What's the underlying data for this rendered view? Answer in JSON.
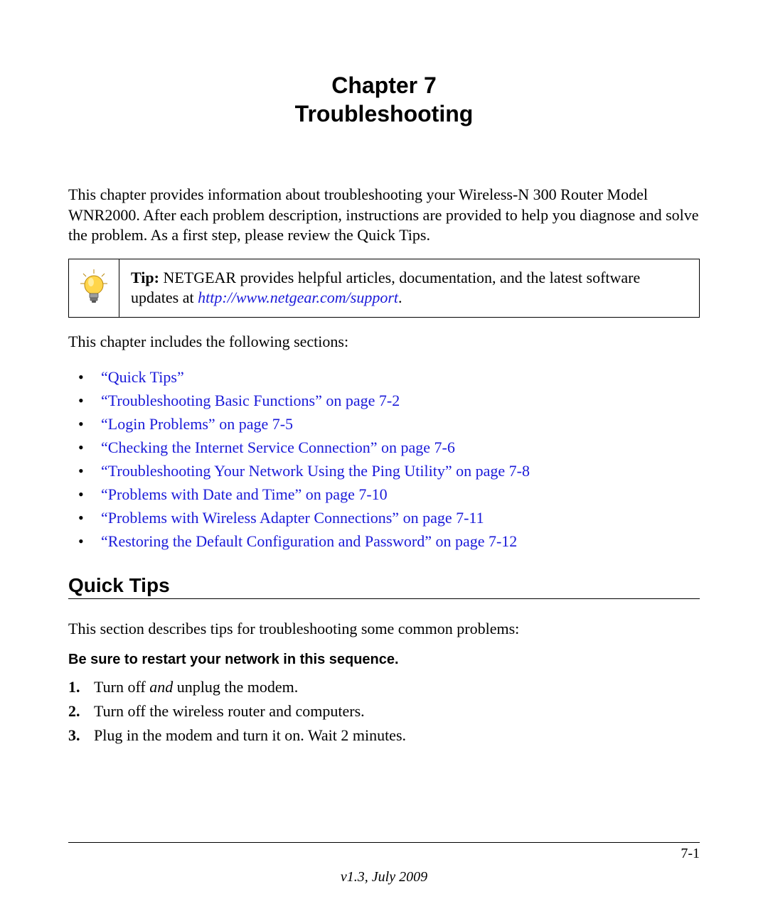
{
  "chapter": {
    "number_line": "Chapter 7",
    "title_line": "Troubleshooting"
  },
  "intro_paragraph": "This chapter provides information about troubleshooting your Wireless-N 300 Router Model WNR2000. After each problem description, instructions are provided to help you diagnose and solve the problem. As a first step, please review the Quick Tips.",
  "tip": {
    "label": "Tip:",
    "text_before_link": " NETGEAR provides helpful articles, documentation, and the latest software updates at ",
    "link_text": "http://www.netgear.com/support",
    "trailing_period": "."
  },
  "sections_intro": "This chapter includes the following sections:",
  "section_links": [
    "“Quick Tips”",
    "“Troubleshooting Basic Functions” on page 7-2",
    "“Login Problems” on page 7-5",
    "“Checking the Internet Service Connection” on page 7-6",
    "“Troubleshooting Your Network Using the Ping Utility” on page 7-8",
    "“Problems with Date and Time” on page 7-10",
    "“Problems with Wireless Adapter Connections” on page 7-11",
    "“Restoring the Default Configuration and Password” on page 7-12"
  ],
  "quick_tips": {
    "heading": "Quick Tips",
    "intro": "This section describes tips for troubleshooting some common problems:",
    "subhead": "Be sure to restart your network in this sequence.",
    "steps": {
      "s1_pre": "Turn off ",
      "s1_em": "and",
      "s1_post": " unplug the modem.",
      "s2": "Turn off the wireless router and computers.",
      "s3": "Plug in the modem and turn it on. Wait 2 minutes."
    }
  },
  "footer": {
    "page_number": "7-1",
    "version": "v1.3, July 2009"
  }
}
